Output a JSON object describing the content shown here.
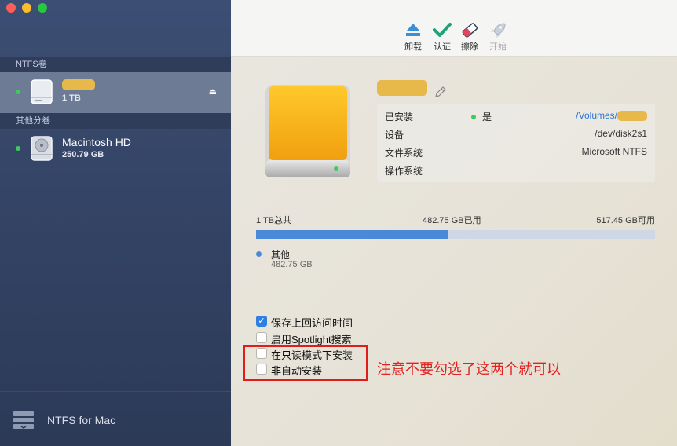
{
  "sidebar": {
    "section_ntfs": "NTFS卷",
    "section_other": "其他分卷",
    "ntfs_volume": {
      "size": "1 TB"
    },
    "other_volume": {
      "name": "Macintosh HD",
      "size": "250.79 GB"
    },
    "eject_symbol": "⏏",
    "footer_label": "NTFS for Mac"
  },
  "toolbar": {
    "unmount": "卸载",
    "verify": "认证",
    "erase": "擦除",
    "start": "开始"
  },
  "disk_info": {
    "rows": [
      {
        "key": "已安装",
        "status": "是",
        "value": "/Volumes/"
      },
      {
        "key": "设备",
        "value": "/dev/disk2s1"
      },
      {
        "key": "文件系统",
        "value": "Microsoft NTFS"
      },
      {
        "key": "操作系统",
        "value": ""
      }
    ]
  },
  "usage": {
    "total": "1 TB总共",
    "used": "482.75 GB已用",
    "free": "517.45 GB可用",
    "used_fraction": 0.483,
    "legend_name": "其他",
    "legend_value": "482.75 GB"
  },
  "options": [
    {
      "label": "保存上回访问时间",
      "checked": true
    },
    {
      "label": "启用Spotlight搜索",
      "checked": false
    },
    {
      "label": "在只读模式下安装",
      "checked": false
    },
    {
      "label": "非自动安装",
      "checked": false
    }
  ],
  "annotation": "注意不要勾选了这两个就可以",
  "colors": {
    "accent": "#2f7fe3",
    "bar_used": "#4a88d9",
    "annotation_red": "#e21b1b",
    "status_green": "#3ecb5b"
  }
}
